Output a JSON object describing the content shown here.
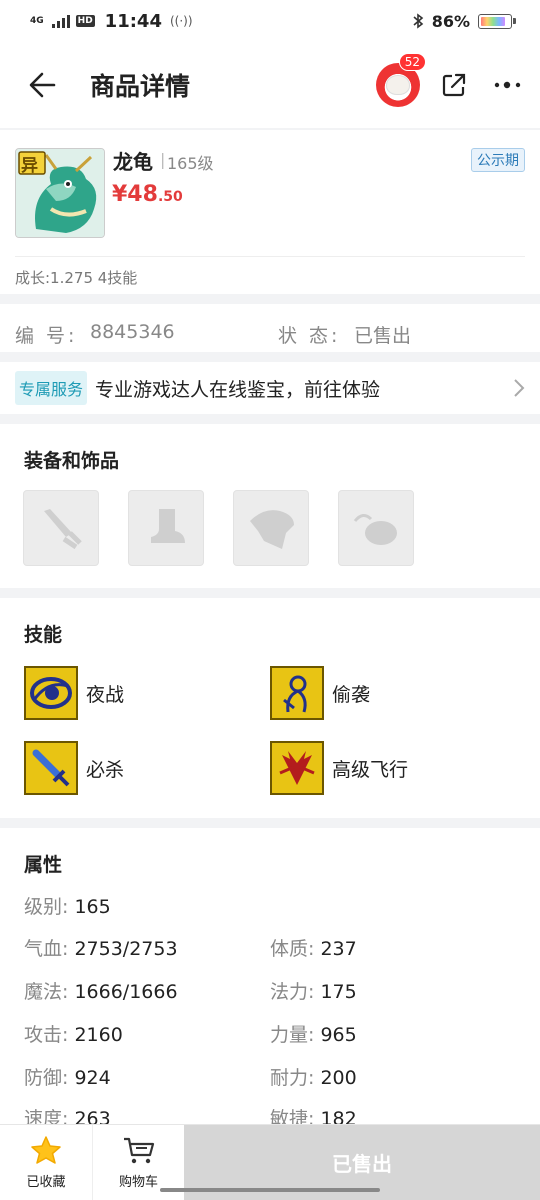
{
  "status_bar": {
    "network": "4G",
    "hd": "HD",
    "time": "11:44",
    "battery": "86%"
  },
  "header": {
    "title": "商品详情",
    "notification_count": "52"
  },
  "product": {
    "name": "龙龟",
    "level": "165级",
    "price_main": "¥48",
    "price_decimal": ".50",
    "tag": "公示期",
    "growth": "成长:1.275 4技能",
    "thumb_badge": "异"
  },
  "info": {
    "id_label": "编 号:",
    "id_value": "8845346",
    "status_label": "状 态:",
    "status_value": "已售出"
  },
  "service": {
    "tag": "专属服务",
    "text": "专业游戏达人在线鉴宝，前往体验"
  },
  "equipment": {
    "title": "装备和饰品",
    "slots": [
      "weapon-slot-icon",
      "boots-slot-icon",
      "armor-slot-icon",
      "accessory-slot-icon"
    ]
  },
  "skills": {
    "title": "技能",
    "items": [
      {
        "name": "夜战",
        "icon": "eye-icon"
      },
      {
        "name": "偷袭",
        "icon": "figure-icon"
      },
      {
        "name": "必杀",
        "icon": "sword-icon"
      },
      {
        "name": "高级飞行",
        "icon": "wings-icon"
      }
    ]
  },
  "attributes": {
    "title": "属性",
    "level": {
      "label": "级别:",
      "value": "165"
    },
    "rows": [
      {
        "label": "气血:",
        "value": "2753/2753"
      },
      {
        "label": "体质:",
        "value": "237"
      },
      {
        "label": "魔法:",
        "value": "1666/1666"
      },
      {
        "label": "法力:",
        "value": "175"
      },
      {
        "label": "攻击:",
        "value": "2160"
      },
      {
        "label": "力量:",
        "value": "965"
      },
      {
        "label": "防御:",
        "value": "924"
      },
      {
        "label": "耐力:",
        "value": "200"
      },
      {
        "label": "速度:",
        "value": "263"
      },
      {
        "label": "敏捷:",
        "value": "182"
      }
    ]
  },
  "bottom_bar": {
    "favorite_label": "已收藏",
    "cart_label": "购物车",
    "sold_label": "已售出"
  },
  "colors": {
    "price": "#e33b3b",
    "tag_blue": "#2c7bb8",
    "service_teal": "#1e9bb5",
    "skill_gold": "#e8c414"
  }
}
